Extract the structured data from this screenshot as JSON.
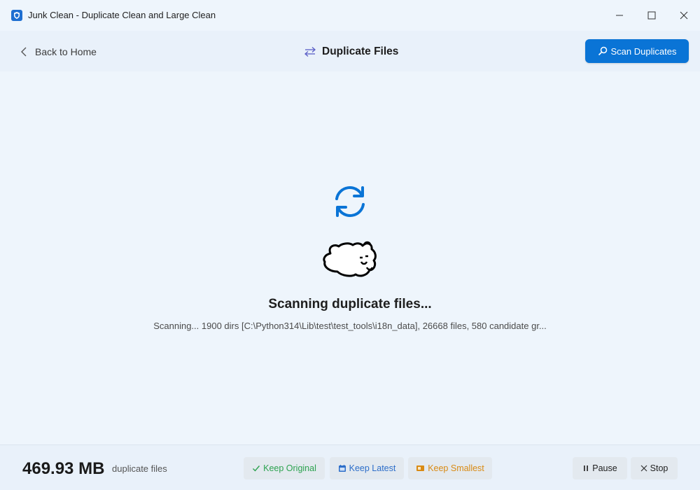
{
  "window": {
    "title": "Junk Clean - Duplicate Clean and Large Clean",
    "icon": "shield-app-icon"
  },
  "header": {
    "back_label": "Back to Home",
    "title": "Duplicate Files",
    "title_icon": "swap-arrows-icon",
    "scan_button_label": "Scan Duplicates",
    "scan_button_icon": "search-icon"
  },
  "main": {
    "spinner_icon": "sync-icon",
    "mascot": "sleeping-dog-illustration",
    "status_title": "Scanning duplicate files...",
    "status_detail": "Scanning... 1900 dirs [C:\\Python314\\Lib\\test\\test_tools\\i18n_data], 26668 files, 580 candidate gr..."
  },
  "footer": {
    "total_size": "469.93 MB",
    "total_label": "duplicate files",
    "keep_original_label": "Keep Original",
    "keep_latest_label": "Keep Latest",
    "keep_smallest_label": "Keep Smallest",
    "pause_label": "Pause",
    "stop_label": "Stop"
  },
  "colors": {
    "accent": "#0a74d6",
    "keep_original": "#2ca24f",
    "keep_latest": "#2d6ec9",
    "keep_smallest": "#d98a13",
    "background": "#eef5fc"
  }
}
